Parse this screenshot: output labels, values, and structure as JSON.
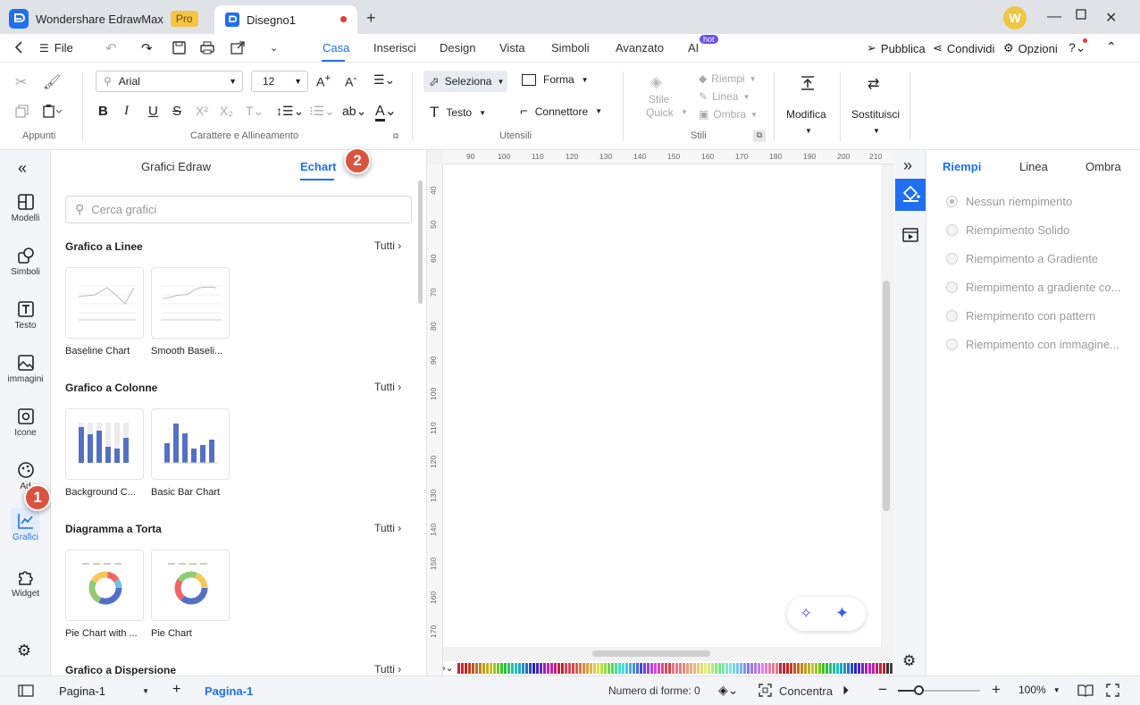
{
  "app": {
    "title": "Wondershare EdrawMax",
    "pro_badge": "Pro",
    "document_tab": "Disegno1",
    "avatar_letter": "W"
  },
  "menu": {
    "file": "File",
    "tabs": [
      "Casa",
      "Inserisci",
      "Design",
      "Vista",
      "Simboli",
      "Avanzato",
      "AI"
    ],
    "hot": "hot",
    "pubblica": "Pubblica",
    "condividi": "Condividi",
    "opzioni": "Opzioni"
  },
  "ribbon": {
    "font": "Arial",
    "size": "12",
    "groups": {
      "appunti": "Appunti",
      "carattere": "Carattere e Allineamento",
      "utensili": "Utensili",
      "stili": "Stili"
    },
    "seleziona": "Seleziona",
    "forma": "Forma",
    "testo": "Testo",
    "connettore": "Connettore",
    "stile_quick_1": "Stile",
    "stile_quick_2": "Quick",
    "riempi": "Riempi",
    "linea": "Linea",
    "ombra": "Ombra",
    "modifica": "Modifica",
    "sostituisci": "Sostituisci"
  },
  "sidebar": {
    "items": [
      "Modelli",
      "Simboli",
      "Testo",
      "immagini",
      "Icone",
      "Ad",
      "Grafici",
      "Widget"
    ]
  },
  "badges": {
    "one": "1",
    "two": "2"
  },
  "panel": {
    "tab_edraw": "Grafici Edraw",
    "tab_echart": "Echart",
    "search_placeholder": "Cerca grafici",
    "tutti": "Tutti",
    "sections": [
      {
        "title": "Grafico a Linee",
        "items": [
          "Baseline Chart",
          "Smooth Baseli..."
        ]
      },
      {
        "title": "Grafico a Colonne",
        "items": [
          "Background C...",
          "Basic Bar Chart"
        ]
      },
      {
        "title": "Diagramma a Torta",
        "items": [
          "Pie Chart with ...",
          "Pie Chart"
        ]
      },
      {
        "title": "Grafico a Dispersione",
        "items": []
      }
    ]
  },
  "ruler": {
    "h": [
      "90",
      "100",
      "110",
      "120",
      "130",
      "140",
      "150",
      "160",
      "170",
      "180",
      "190",
      "200",
      "210"
    ],
    "v": [
      "40",
      "50",
      "60",
      "70",
      "80",
      "90",
      "100",
      "110",
      "120",
      "130",
      "140",
      "150",
      "160",
      "170"
    ]
  },
  "right_panel": {
    "tabs": [
      "Riempi",
      "Linea",
      "Ombra"
    ],
    "options": [
      "Nessun riempimento",
      "Riempimento Solido",
      "Riempimento a Gradiente",
      "Riempimento a gradiente co...",
      "Riempimento con pattern",
      "Riempimento con immagine..."
    ]
  },
  "status": {
    "page_select": "Pagina-1",
    "page_tab": "Pagina-1",
    "shapes": "Numero di forme: 0",
    "focus": "Concentra",
    "zoom": "100%"
  },
  "colors": {
    "accent": "#1f6ff0",
    "badge": "#d9543f"
  }
}
